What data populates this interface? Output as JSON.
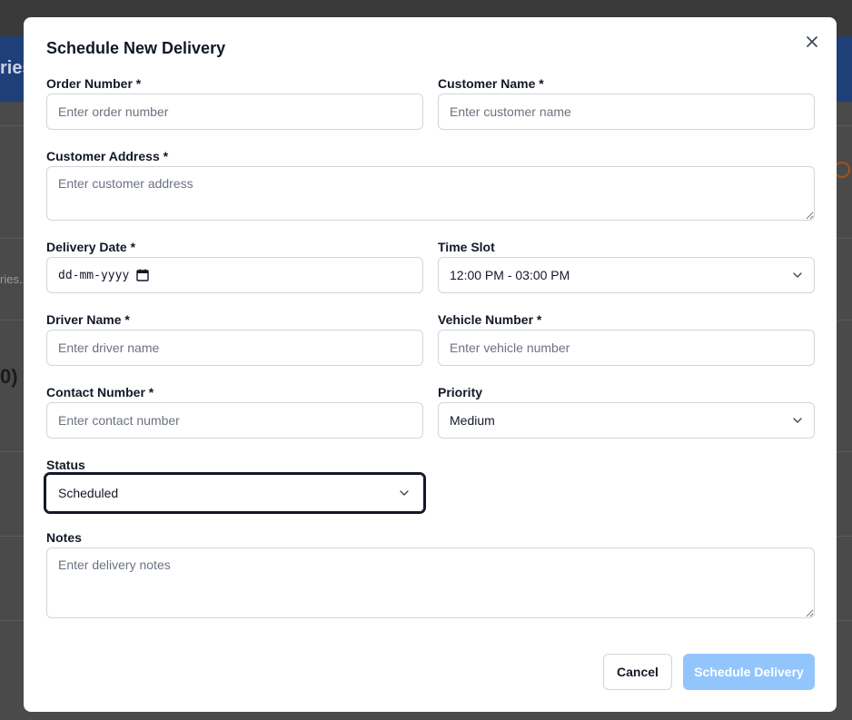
{
  "background": {
    "header_fragment": "ries",
    "search_fragment": "ries...",
    "count_fragment": "0)"
  },
  "modal": {
    "title": "Schedule New Delivery",
    "close_icon": "close-icon",
    "fields": {
      "order_number": {
        "label": "Order Number *",
        "placeholder": "Enter order number",
        "value": ""
      },
      "customer_name": {
        "label": "Customer Name *",
        "placeholder": "Enter customer name",
        "value": ""
      },
      "customer_address": {
        "label": "Customer Address *",
        "placeholder": "Enter customer address",
        "value": ""
      },
      "delivery_date": {
        "label": "Delivery Date *",
        "value": "dd-mm-yyyy",
        "icon": "calendar-icon"
      },
      "time_slot": {
        "label": "Time Slot",
        "value": "12:00 PM - 03:00 PM"
      },
      "driver_name": {
        "label": "Driver Name *",
        "placeholder": "Enter driver name",
        "value": ""
      },
      "vehicle_number": {
        "label": "Vehicle Number *",
        "placeholder": "Enter vehicle number",
        "value": ""
      },
      "contact_number": {
        "label": "Contact Number *",
        "placeholder": "Enter contact number",
        "value": ""
      },
      "priority": {
        "label": "Priority",
        "value": "Medium"
      },
      "status": {
        "label": "Status",
        "value": "Scheduled"
      },
      "notes": {
        "label": "Notes",
        "placeholder": "Enter delivery notes",
        "value": ""
      }
    },
    "buttons": {
      "cancel": "Cancel",
      "submit": "Schedule Delivery"
    }
  },
  "colors": {
    "primary_disabled": "#93c5fd",
    "border": "#d1d5db",
    "overlay_header": "#1f3f78"
  }
}
